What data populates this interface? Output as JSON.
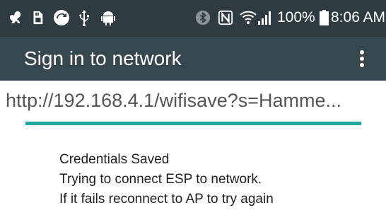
{
  "status_bar": {
    "notification_icons": [
      "squirrel-icon",
      "sd-card-icon",
      "sync-icon",
      "usb-icon",
      "android-icon"
    ],
    "system_icons": [
      "bluetooth-icon",
      "nfc-icon",
      "wifi-icon",
      "cell-signal-icon",
      "battery-icon"
    ],
    "battery_percent": "100%",
    "time": "8:06 AM"
  },
  "app_bar": {
    "title": "Sign in to network",
    "menu_icon": "more-vert-icon"
  },
  "url_bar": {
    "url": "http://192.168.4.1/wifisave?s=Hamme..."
  },
  "content": {
    "lines": [
      "Credentials Saved",
      "Trying to connect ESP to network.",
      "If it fails reconnect to AP to try again"
    ]
  },
  "colors": {
    "status_bar_bg": "#2e3b41",
    "app_bar_bg": "#37474f",
    "progress_accent": "#21a9a0"
  }
}
